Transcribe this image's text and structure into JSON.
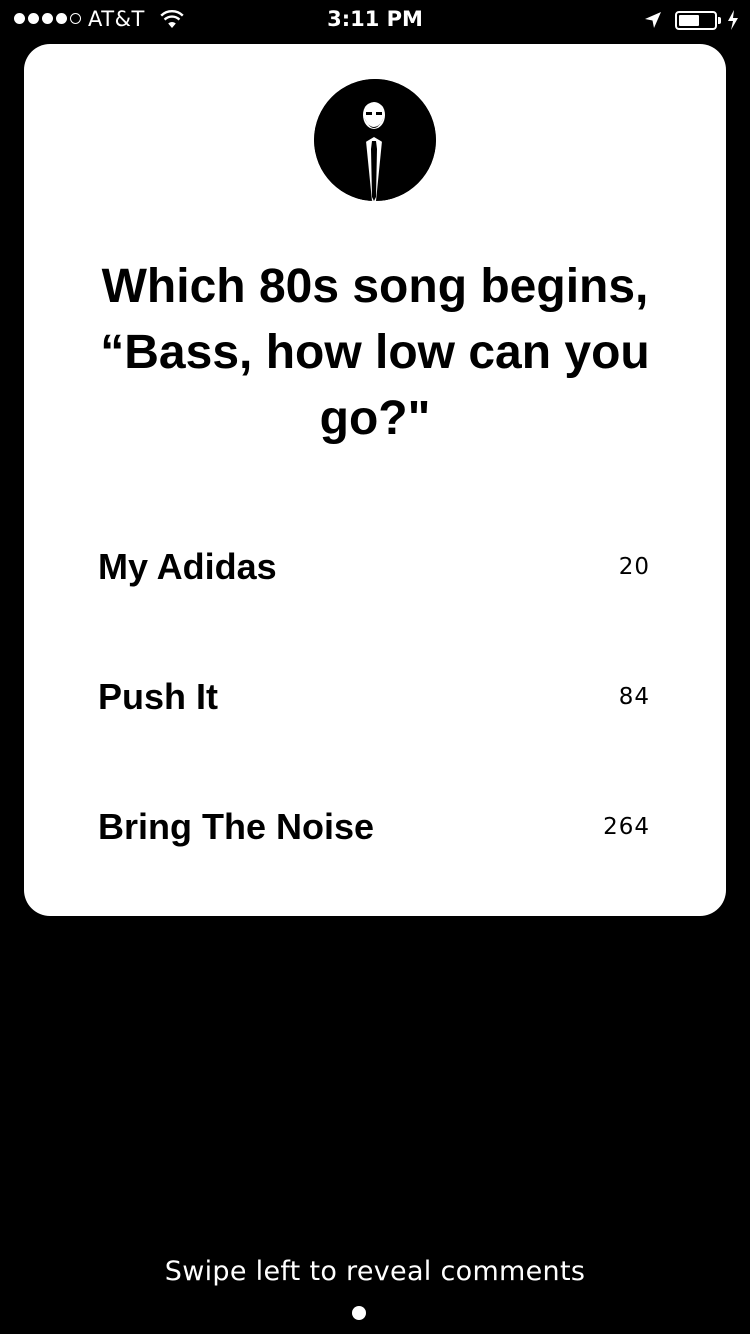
{
  "status_bar": {
    "signal_bars": {
      "filled": 4,
      "total": 5
    },
    "carrier": "AT&T",
    "time": "3:11 PM",
    "battery_level": 0.6,
    "icons": [
      "wifi-icon",
      "location-arrow-icon",
      "battery-icon",
      "charging-bolt-icon"
    ]
  },
  "card": {
    "avatar": "avatar",
    "question": "Which 80s song begins, “Bass, how low can you go?\"",
    "answers": [
      {
        "label": "My Adidas",
        "count": "20"
      },
      {
        "label": "Push It",
        "count": "84"
      },
      {
        "label": "Bring The Noise",
        "count": "264"
      }
    ]
  },
  "footer": {
    "hint": "Swipe left to reveal comments"
  },
  "colors": {
    "background": "#000000",
    "card": "#ffffff",
    "text_on_card": "#000000",
    "text_on_background": "#ffffff"
  }
}
